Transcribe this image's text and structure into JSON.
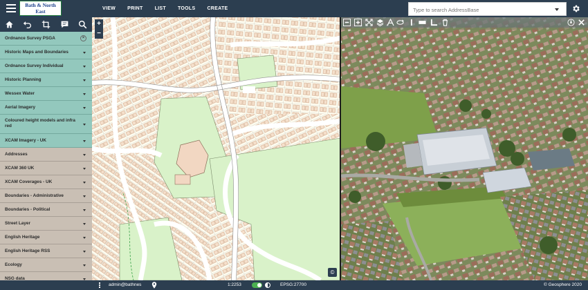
{
  "header": {
    "logo_line1": "Bath & North East",
    "logo_line2": "Somerset Council",
    "menu": [
      "VIEW",
      "PRINT",
      "LIST",
      "TOOLS",
      "CREATE"
    ],
    "search_placeholder": "Type to search AddressBase"
  },
  "sidebar": {
    "tools": [
      "home-icon",
      "undo-icon",
      "crop-icon",
      "comment-icon",
      "search-icon"
    ],
    "layers": [
      {
        "label": "Ordnance Survey PSGA",
        "style": "teal",
        "control": "close"
      },
      {
        "label": "Historic Maps and Boundaries",
        "style": "teal"
      },
      {
        "label": "Ordnance Survey Individual",
        "style": "teal"
      },
      {
        "label": "Historic Planning",
        "style": "teal"
      },
      {
        "label": "Wessex Water",
        "style": "teal"
      },
      {
        "label": "Aerial Imagery",
        "style": "teal"
      },
      {
        "label": "Coloured height models and infra red",
        "style": "teal",
        "tall": true
      },
      {
        "label": "XCAM Imagery - UK",
        "style": "teal"
      },
      {
        "label": "Addresses",
        "style": "tan"
      },
      {
        "label": "XCAM 360 UK",
        "style": "tan"
      },
      {
        "label": "XCAM Coverages - UK",
        "style": "tan"
      },
      {
        "label": "Boundaries - Administrative",
        "style": "tan"
      },
      {
        "label": "Boundaries - Political",
        "style": "tan"
      },
      {
        "label": "Street Layer",
        "style": "tan"
      },
      {
        "label": "English Heritage",
        "style": "tan"
      },
      {
        "label": "English Heritage RSS",
        "style": "tan"
      },
      {
        "label": "Ecology",
        "style": "tan"
      },
      {
        "label": "NSG data",
        "style": "tan"
      }
    ]
  },
  "map": {
    "zoom_in": "+",
    "zoom_out": "−",
    "copyright_symbol": "©"
  },
  "status": {
    "user": "admin@bathnes",
    "scale": "1:2253",
    "epsg": "EPSG:27700",
    "copyright": "© Geosphere 2020"
  },
  "colors": {
    "header_bg": "#2c3e50",
    "layer_teal": "#93c8bd",
    "layer_tan": "#c9bfb4",
    "toggle_on": "#4caf50"
  }
}
